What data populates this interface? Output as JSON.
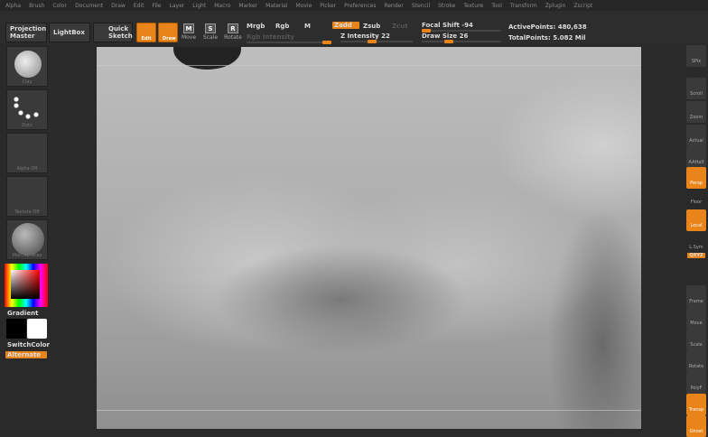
{
  "menu": [
    "Alpha",
    "Brush",
    "Color",
    "Document",
    "Draw",
    "Edit",
    "File",
    "Layer",
    "Light",
    "Macro",
    "Marker",
    "Material",
    "Movie",
    "Picker",
    "Preferences",
    "Render",
    "Stencil",
    "Stroke",
    "Texture",
    "Tool",
    "Transform",
    "Zplugin",
    "Zscript"
  ],
  "toolbar": {
    "projection_master": "Projection Master",
    "lightbox": "LightBox",
    "quick_sketch": "Quick Sketch",
    "edit": "Edit",
    "draw": "Draw",
    "move": "Move",
    "scale": "Scale",
    "rotate": "Rotate",
    "mrgb": "Mrgb",
    "rgb": "Rgb",
    "m": "M",
    "rgb_intensity": "Rgb Intensity",
    "zadd": "Zadd",
    "zsub": "Zsub",
    "zcut": "Zcut",
    "z_intensity": "Z Intensity 22",
    "focal_shift": "Focal Shift -94",
    "draw_size": "Draw Size 26",
    "active_points": "ActivePoints: 480,638",
    "total_points": "TotalPoints: 5.082 Mil"
  },
  "sliders": {
    "z_intensity": 22,
    "focal_shift": -94,
    "draw_size": 26
  },
  "left": {
    "brush": "Clay",
    "stroke": "Dots",
    "alpha": "Alpha Off",
    "texture": "Texture Off",
    "material": "MatCap Gray",
    "gradient": "Gradient",
    "switch_color": "SwitchColor",
    "alternate": "Alternate"
  },
  "right": [
    "SPix",
    "Scroll",
    "Zoom",
    "Actual",
    "AAHalf",
    "Persp",
    "Floor",
    "Local",
    "L.Sym",
    "QXYZ",
    "Frame",
    "Move",
    "Scale",
    "Rotate",
    "PolyF",
    "Transp",
    "Ghost"
  ],
  "colors": {
    "accent": "#e8841a"
  }
}
